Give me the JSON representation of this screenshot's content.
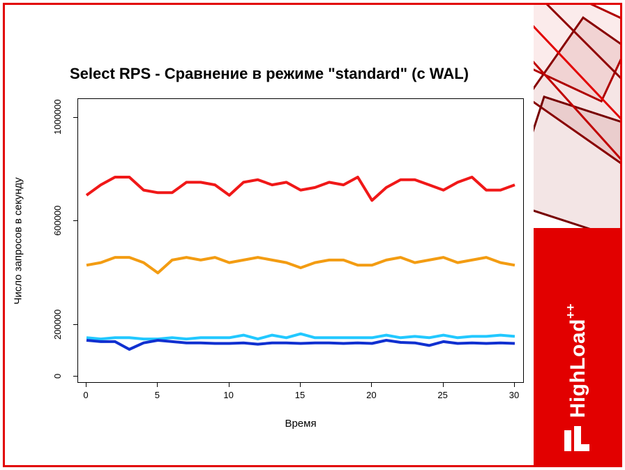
{
  "title": "Select RPS - Сравнение в режиме \"standard\" (с WAL)",
  "xlabel": "Время",
  "ylabel": "Число запросов в секунду",
  "brand": "HighLoad",
  "brand_sup": "++",
  "chart_data": {
    "type": "line",
    "title": "Select RPS - Сравнение в режиме \"standard\" (с WAL)",
    "xlabel": "Время",
    "ylabel": "Число запросов в секунду",
    "xlim": [
      0,
      30
    ],
    "ylim": [
      0,
      1050000
    ],
    "xticks": [
      0,
      5,
      10,
      15,
      20,
      25,
      30
    ],
    "yticks": [
      0,
      200000,
      600000,
      1000000
    ],
    "x": [
      0,
      1,
      2,
      3,
      4,
      5,
      6,
      7,
      8,
      9,
      10,
      11,
      12,
      13,
      14,
      15,
      16,
      17,
      18,
      19,
      20,
      21,
      22,
      23,
      24,
      25,
      26,
      27,
      28,
      29,
      30
    ],
    "series": [
      {
        "name": "series-red",
        "color": "#f01818",
        "values": [
          700000,
          740000,
          770000,
          770000,
          720000,
          710000,
          710000,
          750000,
          750000,
          740000,
          700000,
          750000,
          760000,
          740000,
          750000,
          720000,
          730000,
          750000,
          740000,
          770000,
          680000,
          730000,
          760000,
          760000,
          740000,
          720000,
          750000,
          770000,
          720000,
          720000,
          740000
        ]
      },
      {
        "name": "series-orange",
        "color": "#f39c12",
        "values": [
          430000,
          440000,
          460000,
          460000,
          440000,
          400000,
          450000,
          460000,
          450000,
          460000,
          440000,
          450000,
          460000,
          450000,
          440000,
          420000,
          440000,
          450000,
          450000,
          430000,
          430000,
          450000,
          460000,
          440000,
          450000,
          460000,
          440000,
          450000,
          460000,
          440000,
          430000
        ]
      },
      {
        "name": "series-cyan",
        "color": "#22c8ff",
        "values": [
          150000,
          145000,
          150000,
          150000,
          145000,
          145000,
          150000,
          145000,
          150000,
          150000,
          150000,
          160000,
          145000,
          160000,
          150000,
          165000,
          150000,
          150000,
          150000,
          150000,
          150000,
          160000,
          150000,
          155000,
          150000,
          160000,
          150000,
          155000,
          155000,
          160000,
          155000
        ]
      },
      {
        "name": "series-blue",
        "color": "#1030d0",
        "values": [
          140000,
          135000,
          135000,
          105000,
          130000,
          140000,
          135000,
          130000,
          130000,
          128000,
          128000,
          130000,
          125000,
          130000,
          130000,
          128000,
          130000,
          130000,
          128000,
          130000,
          128000,
          140000,
          132000,
          130000,
          120000,
          135000,
          128000,
          130000,
          128000,
          130000,
          128000
        ]
      }
    ]
  }
}
